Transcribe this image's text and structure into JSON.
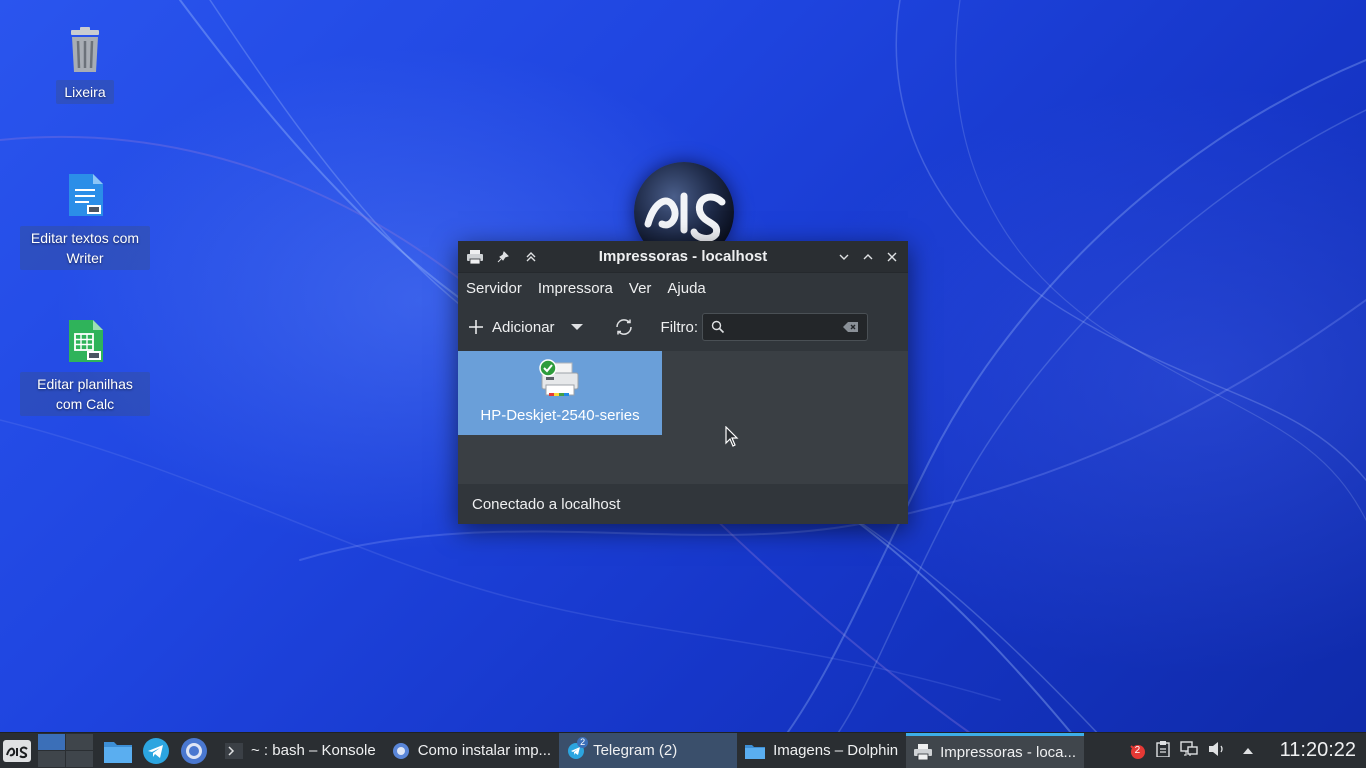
{
  "desktop": {
    "icons": [
      {
        "label": "Lixeira"
      },
      {
        "label": "Editar textos com Writer"
      },
      {
        "label": "Editar planilhas com Calc"
      }
    ]
  },
  "window": {
    "title": "Impressoras - localhost",
    "menu": [
      "Servidor",
      "Impressora",
      "Ver",
      "Ajuda"
    ],
    "toolbar": {
      "add_label": "Adicionar",
      "filter_label": "Filtro:",
      "filter_value": ""
    },
    "printers": [
      {
        "name": "HP-Deskjet-2540-series",
        "selected": true,
        "status": "ready"
      }
    ],
    "status": "Conectado a localhost"
  },
  "taskbar": {
    "tasks": [
      {
        "label": "~ : bash – Konsole",
        "icon": "terminal-icon"
      },
      {
        "label": "Como instalar imp...",
        "icon": "browser-icon"
      },
      {
        "label": "Telegram (2)",
        "icon": "telegram-icon",
        "badge": "2"
      },
      {
        "label": "Imagens – Dolphin",
        "icon": "folder-icon"
      },
      {
        "label": "Impressoras - loca...",
        "icon": "printer-icon"
      }
    ],
    "tray_badge": "2",
    "clock": "11:20:22"
  },
  "colors": {
    "accent": "#3daee9",
    "selection": "#6a9fd9",
    "window_bg": "#31363b",
    "taskbar_bg": "#2a2e32"
  }
}
